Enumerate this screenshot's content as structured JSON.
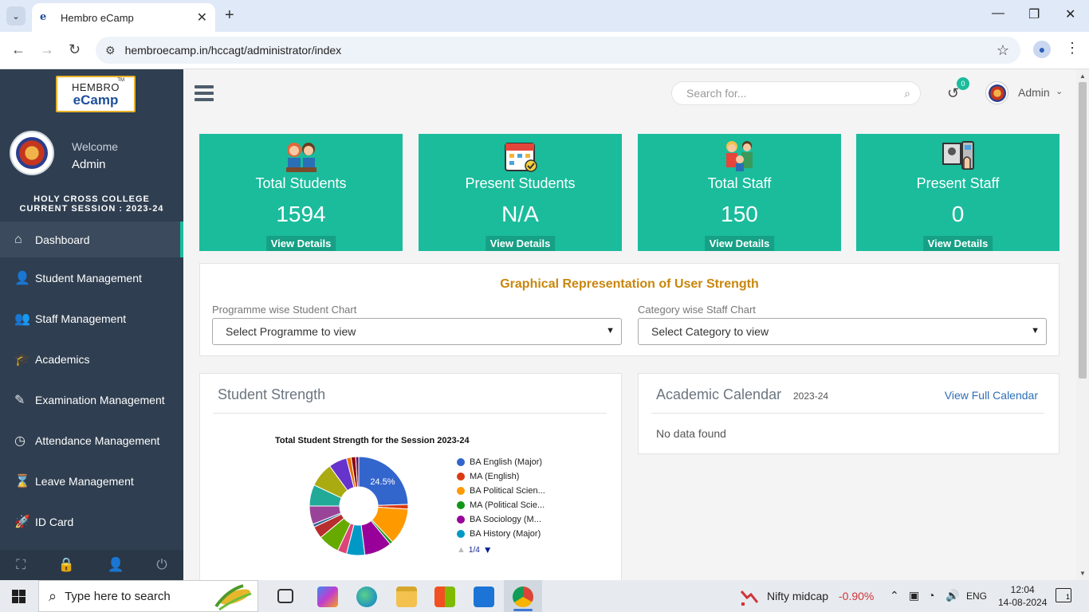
{
  "browser": {
    "tab_title": "Hembro eCamp",
    "favicon": "e",
    "url": "hembroecamp.in/hccagt/administrator/index"
  },
  "sidebar": {
    "logo_top": "HEMBRO",
    "logo_bottom": "eCamp",
    "logo_tm": "TM",
    "welcome": "Welcome",
    "username": "Admin",
    "college_line1": "HOLY CROSS COLLEGE",
    "college_line2": "CURRENT SESSION : 2023-24",
    "items": [
      {
        "label": "Dashboard",
        "icon": "home-icon",
        "glyph": "⌂"
      },
      {
        "label": "Student Management",
        "icon": "user-icon",
        "glyph": "👤"
      },
      {
        "label": "Staff Management",
        "icon": "users-icon",
        "glyph": "👥"
      },
      {
        "label": "Academics",
        "icon": "graduation-cap-icon",
        "glyph": "🎓"
      },
      {
        "label": "Examination Management",
        "icon": "edit-icon",
        "glyph": "✎"
      },
      {
        "label": "Attendance Management",
        "icon": "clock-icon",
        "glyph": "◷"
      },
      {
        "label": "Leave Management",
        "icon": "hourglass-icon",
        "glyph": "⌛"
      },
      {
        "label": "ID Card",
        "icon": "rocket-icon",
        "glyph": "🚀"
      }
    ],
    "active_index": 0
  },
  "header": {
    "search_placeholder": "Search for...",
    "notification_count": "0",
    "admin_name": "Admin"
  },
  "cards": [
    {
      "label": "Total Students",
      "value": "1594",
      "button": "View Details",
      "icon": "students-icon"
    },
    {
      "label": "Present Students",
      "value": "N/A",
      "button": "View Details",
      "icon": "calendar-check-icon"
    },
    {
      "label": "Total Staff",
      "value": "150",
      "button": "View Details",
      "icon": "staff-family-icon"
    },
    {
      "label": "Present Staff",
      "value": "0",
      "button": "View Details",
      "icon": "biometric-icon"
    }
  ],
  "graph_panel": {
    "title": "Graphical Representation of User Strength",
    "programme_label": "Programme wise Student Chart",
    "programme_select": "Select Programme to view",
    "category_label": "Category wise Staff Chart",
    "category_select": "Select Category to view"
  },
  "strength_panel": {
    "title": "Student Strength",
    "pager": "1/4"
  },
  "calendar_panel": {
    "title": "Academic Calendar",
    "session": "2023-24",
    "link": "View Full Calendar",
    "empty": "No data found"
  },
  "chart_data": {
    "type": "pie",
    "title": "Total Student Strength for the Session 2023-24",
    "donut": true,
    "slice_label": "24.5%",
    "categories": [
      "BA English (Major)",
      "MA (English)",
      "BA Political Scien...",
      "MA (Political Scie...",
      "BA Sociology (M...",
      "BA History (Major)"
    ],
    "slices": [
      {
        "name": "BA English (Major)",
        "value": 24.5,
        "color": "#3366cc",
        "show_in_legend": true
      },
      {
        "name": "MA (English)",
        "value": 1.5,
        "color": "#dc3912",
        "show_in_legend": true
      },
      {
        "name": "BA Political Scien...",
        "value": 12,
        "color": "#ff9900",
        "show_in_legend": true
      },
      {
        "name": "MA (Political Scie...",
        "value": 1,
        "color": "#109618",
        "show_in_legend": true
      },
      {
        "name": "BA Sociology (M...",
        "value": 9,
        "color": "#990099",
        "show_in_legend": true
      },
      {
        "name": "BA History (Major)",
        "value": 6,
        "color": "#0099c6",
        "show_in_legend": true
      },
      {
        "name": "",
        "value": 3,
        "color": "#dd4477",
        "show_in_legend": false
      },
      {
        "name": "",
        "value": 7,
        "color": "#66aa00",
        "show_in_legend": false
      },
      {
        "name": "",
        "value": 4,
        "color": "#b82e2e",
        "show_in_legend": false
      },
      {
        "name": "",
        "value": 1,
        "color": "#316395",
        "show_in_legend": false
      },
      {
        "name": "",
        "value": 6,
        "color": "#994499",
        "show_in_legend": false
      },
      {
        "name": "",
        "value": 7,
        "color": "#22aa99",
        "show_in_legend": false
      },
      {
        "name": "",
        "value": 8,
        "color": "#aaaa11",
        "show_in_legend": false
      },
      {
        "name": "",
        "value": 6,
        "color": "#6633cc",
        "show_in_legend": false
      },
      {
        "name": "",
        "value": 1.5,
        "color": "#e67300",
        "show_in_legend": false
      },
      {
        "name": "",
        "value": 1.5,
        "color": "#8b0707",
        "show_in_legend": false
      },
      {
        "name": "",
        "value": 1,
        "color": "#651067",
        "show_in_legend": false
      }
    ]
  },
  "taskbar": {
    "search_placeholder": "Type here to search",
    "ticker_name": "Nifty midcap",
    "ticker_value": "-0.90%",
    "language": "ENG",
    "time": "12:04",
    "date": "14-08-2024",
    "notifications": "1"
  },
  "colors": {
    "sidebar": "#2f3e50",
    "accent": "#1abc9c",
    "title_orange": "#c9860c",
    "link_blue": "#2d6fb7"
  }
}
